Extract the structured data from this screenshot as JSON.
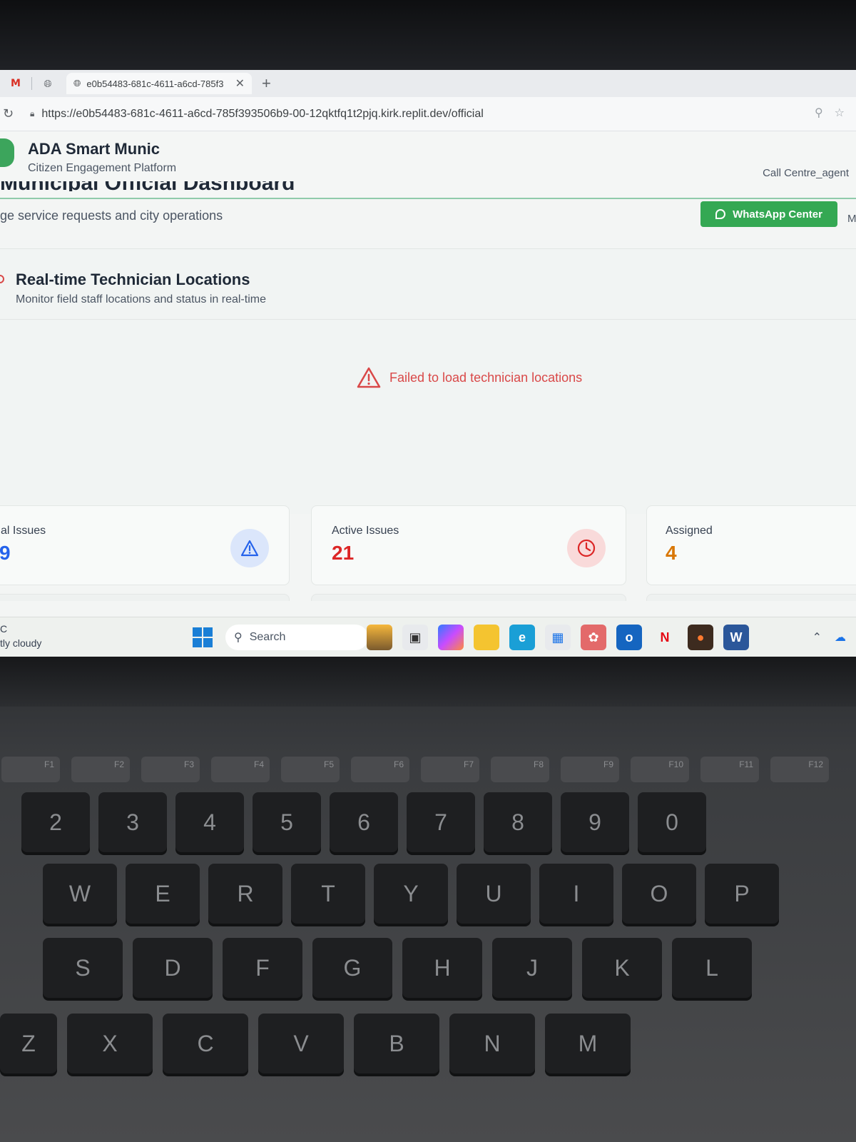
{
  "browser": {
    "tab_title": "e0b54483-681c-4611-a6cd-785f3",
    "gmail_icon": "M",
    "new_tab": "+",
    "url": "https://e0b54483-681c-4611-a6cd-785f393506b9-00-12qktfq1t2pjq.kirk.replit.dev/official"
  },
  "app": {
    "title": "ADA Smart Munic",
    "subtitle": "Citizen Engagement Platform",
    "role": "Call Centre_agent",
    "page_title": "Municipal Official Dashboard",
    "page_subtitle": "ge service requests and city operations",
    "whatsapp_label": "WhatsApp Center",
    "more_cut": "M",
    "brand_color": "#34a853"
  },
  "technicians": {
    "title": "Real-time Technician Locations",
    "subtitle": "Monitor field staff locations and status in real-time",
    "error": "Failed to load technician locations",
    "error_color": "#d94848"
  },
  "stats": [
    {
      "label": "al Issues",
      "value": "9",
      "icon": "alert-triangle-icon",
      "color": "#2563eb"
    },
    {
      "label": "Active Issues",
      "value": "21",
      "icon": "clock-icon",
      "color": "#dc2626"
    },
    {
      "label": "Assigned",
      "value": "4",
      "icon": "",
      "color": "#d97706"
    }
  ],
  "taskbar": {
    "weather_temp": "C",
    "weather_desc": "tly cloudy",
    "search_placeholder": "Search"
  },
  "keyboard": {
    "fkeys": [
      "F1",
      "F2",
      "F3",
      "F4",
      "F5",
      "F6",
      "F7",
      "F8",
      "F9",
      "F10",
      "F11",
      "F12"
    ],
    "num_row": [
      "2",
      "3",
      "4",
      "5",
      "6",
      "7",
      "8",
      "9",
      "0"
    ],
    "row_q": [
      "W",
      "E",
      "R",
      "T",
      "Y",
      "U",
      "I",
      "O",
      "P"
    ],
    "row_a": [
      "S",
      "D",
      "F",
      "G",
      "H",
      "J",
      "K",
      "L"
    ],
    "row_z": [
      "Z",
      "X",
      "C",
      "V",
      "B",
      "N",
      "M"
    ]
  }
}
